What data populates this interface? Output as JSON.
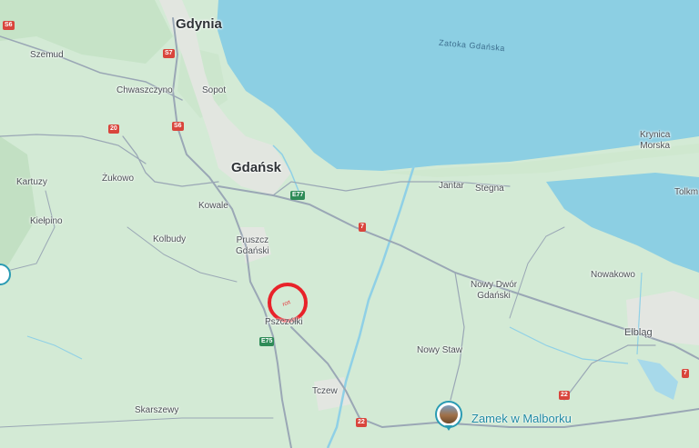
{
  "map": {
    "cities": {
      "gdynia": "Gdynia",
      "gdansk": "Gdańsk"
    },
    "water": {
      "zatoka": "Zatoka Gdańska"
    },
    "places": {
      "szemud": "Szemud",
      "chwaszczyno": "Chwaszczyno",
      "sopot": "Sopot",
      "zukowo": "Żukowo",
      "kartuzy": "Kartuzy",
      "kielpino": "Kiełpino",
      "kowale": "Kowale",
      "kolbudy": "Kolbudy",
      "pruszcz_line1": "Pruszcz",
      "pruszcz_line2": "Gdański",
      "pszczolki": "Pszczółki",
      "tczew": "Tczew",
      "skarszewy": "Skarszewy",
      "jantar": "Jantar",
      "stegna": "Stegna",
      "krynica_line1": "Krynica",
      "krynica_line2": "Morska",
      "tolkmicko": "Tolkm",
      "nowakowo": "Nowakowo",
      "nowy_dwor_line1": "Nowy Dwór",
      "nowy_dwor_line2": "Gdański",
      "nowy_staw": "Nowy Staw",
      "elblag": "Elbląg"
    },
    "shields": {
      "s6_top": "S6",
      "s7": "S7",
      "s6_mid": "S6",
      "r20": "20",
      "e77": "E77",
      "r7": "7",
      "e75": "E75",
      "r22_a": "22",
      "r22_b": "22",
      "r7_right": "7"
    },
    "marker": {
      "label": "rcrt"
    },
    "poi": {
      "label": "Zamek w Malborku",
      "icon": "castle-photo-icon"
    },
    "colors": {
      "land": "#d3ead5",
      "sea": "#8ccfe3",
      "road": "#9aa7b5",
      "urban": "#e4e4e2",
      "marker": "#e8232a"
    }
  }
}
